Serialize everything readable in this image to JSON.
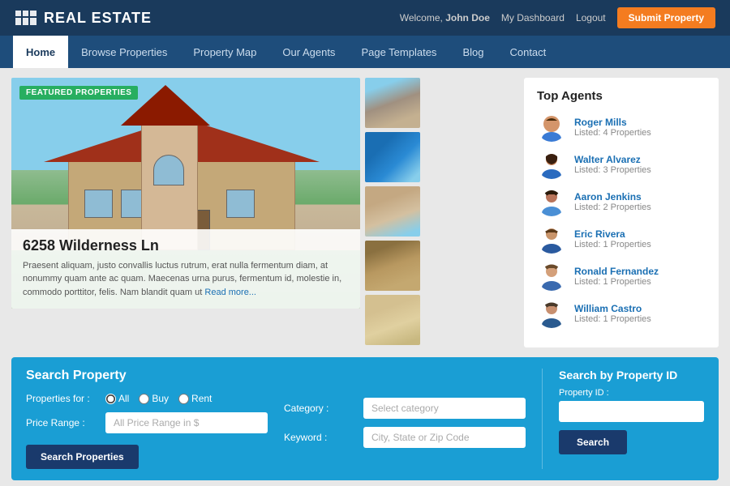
{
  "header": {
    "logo": "REAL ESTATE",
    "welcome_text": "Welcome,",
    "username": "John Doe",
    "dashboard_link": "My Dashboard",
    "logout_link": "Logout",
    "submit_btn": "Submit Property"
  },
  "nav": {
    "items": [
      {
        "label": "Home",
        "active": true
      },
      {
        "label": "Browse Properties",
        "active": false
      },
      {
        "label": "Property Map",
        "active": false
      },
      {
        "label": "Our Agents",
        "active": false
      },
      {
        "label": "Page Templates",
        "active": false
      },
      {
        "label": "Blog",
        "active": false
      },
      {
        "label": "Contact",
        "active": false
      }
    ]
  },
  "featured": {
    "badge": "FEATURED PROPERTIES",
    "title": "6258 Wilderness Ln",
    "description": "Praesent aliquam, justo convallis luctus rutrum, erat nulla fermentum diam, at nonummy quam ante ac quam. Maecenas urna purus, fermentum id, molestie in, commodo porttitor, felis. Nam blandit quam ut",
    "read_more": "Read more..."
  },
  "top_agents": {
    "title": "Top Agents",
    "agents": [
      {
        "name": "Roger Mills",
        "listed": "Listed: 4 Properties"
      },
      {
        "name": "Walter Alvarez",
        "listed": "Listed: 3 Properties"
      },
      {
        "name": "Aaron Jenkins",
        "listed": "Listed: 2 Properties"
      },
      {
        "name": "Eric Rivera",
        "listed": "Listed: 1 Properties"
      },
      {
        "name": "Ronald Fernandez",
        "listed": "Listed: 1 Properties"
      },
      {
        "name": "William Castro",
        "listed": "Listed: 1 Properties"
      }
    ]
  },
  "search": {
    "title": "Search Property",
    "properties_for_label": "Properties for :",
    "radio_options": [
      "All",
      "Buy",
      "Rent"
    ],
    "category_label": "Category :",
    "category_placeholder": "Select category",
    "price_label": "Price Range :",
    "price_placeholder": "All Price Range in $",
    "keyword_label": "Keyword :",
    "keyword_placeholder": "City, State or Zip Code",
    "search_btn": "Search Properties"
  },
  "search_by_id": {
    "title": "Search by Property ID",
    "property_id_label": "Property ID :",
    "property_id_placeholder": "",
    "search_btn": "Search"
  }
}
